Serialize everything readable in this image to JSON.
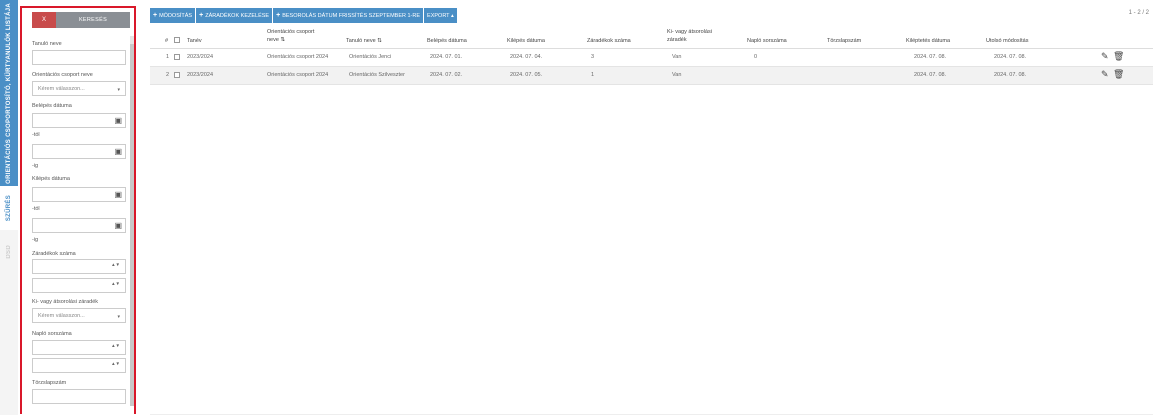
{
  "side_tabs": [
    {
      "label": "ORIENTÁCIÓS CSOPORTOSÍTÓ, KÜRTYANULÓK LISTÁJA"
    },
    {
      "label": "SZŰRÉS"
    },
    {
      "label": "DSD"
    }
  ],
  "filter": {
    "close_label": "X",
    "search_label": "KERESÉS",
    "fields": {
      "tanulo_neve": "Tanuló neve",
      "orientacios_csoport": "Orientációs csoport neve",
      "orientacios_placeholder": "Kérem válasszon...",
      "belepes_datuma": "Belépés dátuma",
      "tol_1": "-tól",
      "ig_1": "-ig",
      "kilepes_datuma": "Kilépés dátuma",
      "tol_2": "-tól",
      "ig_2": "-ig",
      "zaradekok_szama": "Záradékok száma",
      "ki_vagy_atsorolasi": "Ki- vagy átsorolási záradék",
      "ki_placeholder": "Kérem válasszon...",
      "naplo_sorszama": "Napló sorszáma",
      "torzslapszam": "Törzslapszám"
    }
  },
  "toolbar": {
    "modositas": "MÓDOSÍTÁS",
    "zaradekok": "ZÁRADÉKOK KEZELÉSE",
    "besorolas": "BESOROLÁS DÁTUM FRISSÍTÉS SZEPTEMBER 1-RE",
    "export": "EXPORT ▴"
  },
  "pager": "1 - 2 / 2",
  "table": {
    "headers": {
      "num": "#",
      "tanev": "Tanév",
      "csoport_line1": "Orientációs csoport",
      "csoport_line2": "neve ⇅",
      "tanulo": "Tanuló neve ⇅",
      "belepes": "Belépés dátuma",
      "kilepes": "Kilépés dátuma",
      "zaradekok": "Záradékok száma",
      "ki_line1": "Ki- vagy átsorolási",
      "ki_line2": "záradék",
      "naplo": "Napló sorszáma",
      "torzs": "Törzslapszám",
      "kileptetes": "Kiléptetés dátuma",
      "utolso": "Utolsó módosítás"
    },
    "rows": [
      {
        "num": "1",
        "tanev": "2023/2024",
        "csoport": "Orientációs csoport 2024",
        "tanulo": "Orientációs Jenci",
        "belepes": "2024. 07. 01.",
        "kilepes": "2024. 07. 04.",
        "zaradekok": "3",
        "ki": "Van",
        "naplo": "0",
        "torzs": "",
        "kileptetes": "2024. 07. 08.",
        "utolso": "2024. 07. 08."
      },
      {
        "num": "2",
        "tanev": "2023/2024",
        "csoport": "Orientációs csoport 2024",
        "tanulo": "Orientációs Szilveszter",
        "belepes": "2024. 07. 02.",
        "kilepes": "2024. 07. 05.",
        "zaradekok": "1",
        "ki": "Van",
        "naplo": "",
        "torzs": "",
        "kileptetes": "2024. 07. 08.",
        "utolso": "2024. 07. 08."
      }
    ]
  },
  "icons": {
    "calendar": "▣",
    "caret": "▾",
    "spin": "▲▼",
    "edit": "✎",
    "delete": "🗑"
  },
  "colors": {
    "accent": "#4a8fc6",
    "danger": "#d9182a"
  }
}
